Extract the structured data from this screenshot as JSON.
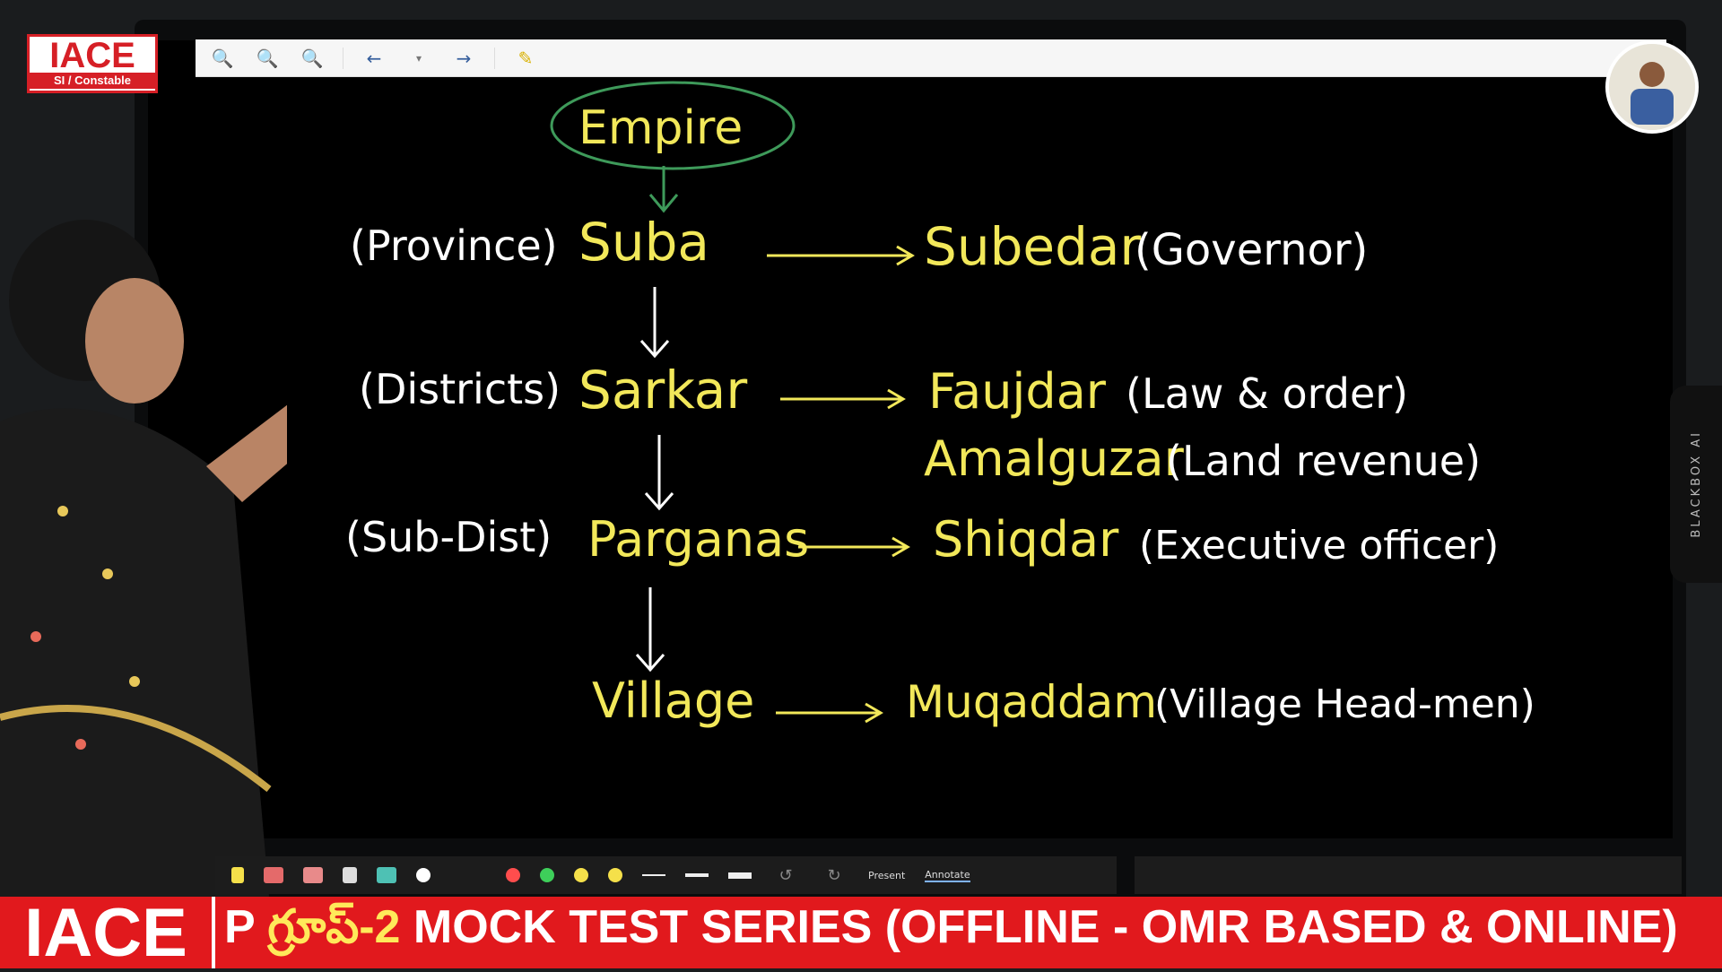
{
  "logo": {
    "title": "IACE",
    "subtitle": "SI / Constable"
  },
  "toolbar_top": {
    "icons": [
      "zoom-fit-icon",
      "zoom-out-icon",
      "zoom-in-icon",
      "back-arrow-icon",
      "page-select-icon",
      "forward-arrow-icon",
      "pen-icon"
    ]
  },
  "board": {
    "top": "Empire",
    "rows": [
      {
        "label": "(Province)",
        "unit": "Suba",
        "officer": "Subedar",
        "role": "(Governor)"
      },
      {
        "label": "(Districts)",
        "unit": "Sarkar",
        "officer": "Faujdar",
        "role": "(Law & order)"
      },
      {
        "label": "",
        "unit": "",
        "officer": "Amalguzar",
        "role": "(Land revenue)"
      },
      {
        "label": "(Sub-Dist)",
        "unit": "Parganas",
        "officer": "Shiqdar",
        "role": "(Executive officer)"
      },
      {
        "label": "",
        "unit": "Village",
        "officer": "Muqaddam",
        "role": "(Village Head-men)"
      }
    ]
  },
  "side_tab": {
    "label": "BLACKBOX AI"
  },
  "toolbar_bottom": {
    "colors": [
      "#ff4d4d",
      "#3ecf5a",
      "#f5e04a",
      "#f5e04a"
    ],
    "modes": [
      "Present",
      "Annotate"
    ],
    "active_mode": "Annotate"
  },
  "banner": {
    "logo": "IACE",
    "prefix": "P ",
    "telugu": "గ్రూప్-2",
    "text": " MOCK TEST SERIES (OFFLINE - OMR BASED & ONLINE)"
  }
}
